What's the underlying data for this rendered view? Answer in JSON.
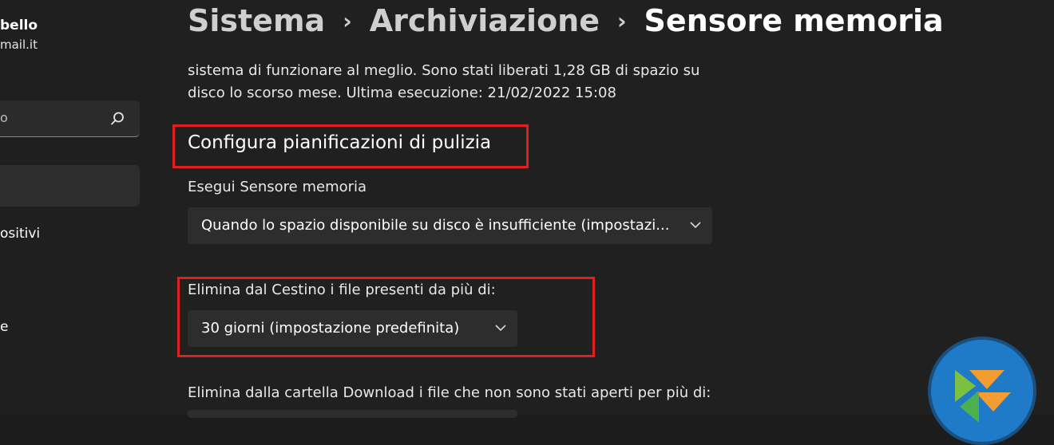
{
  "sidebar": {
    "user_name": "bello",
    "user_email": "mail.it",
    "search_placeholder": "o",
    "nav_devices_label": "ositivi",
    "nav_partial_label": "e"
  },
  "breadcrumb": {
    "items": [
      "Sistema",
      "Archiviazione"
    ],
    "current": "Sensore memoria",
    "separator": "›"
  },
  "description": "sistema di funzionare al meglio. Sono stati liberati 1,28 GB di spazio su disco lo scorso mese. Ultima esecuzione: 21/02/2022 15:08",
  "section": {
    "title": "Configura pianificazioni di pulizia"
  },
  "settings": {
    "run_label": "Esegui Sensore memoria",
    "run_value": "Quando lo spazio disponibile su disco è insufficiente (impostazi...",
    "recycle_label": "Elimina dal Cestino i file presenti da più di:",
    "recycle_value": "30 giorni (impostazione predefinita)",
    "downloads_label": "Elimina dalla cartella Download i file che non sono stati aperti per più di:"
  },
  "colors": {
    "background": "#202020",
    "highlight": "#e0201f",
    "dropdown": "#2d2d2d"
  }
}
